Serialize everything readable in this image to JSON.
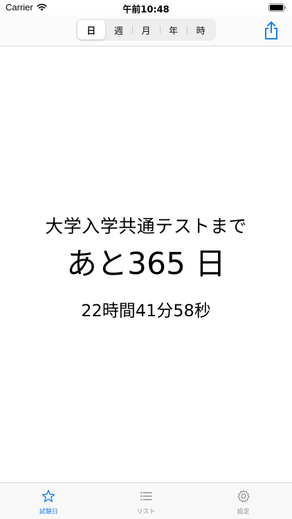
{
  "status_bar": {
    "carrier": "Carrier",
    "time": "午前10:48"
  },
  "segments": {
    "items": [
      "日",
      "週",
      "月",
      "年",
      "時"
    ],
    "selected": "日"
  },
  "main": {
    "title": "大学入学共通テストまで",
    "days_line": "あと365 日",
    "time_line": "22時間41分58秒"
  },
  "tabs": {
    "items": [
      "試験日",
      "リスト",
      "設定"
    ],
    "active": "試験日"
  },
  "colors": {
    "accent": "#1a7cf7",
    "inactive": "#8e8e93"
  }
}
